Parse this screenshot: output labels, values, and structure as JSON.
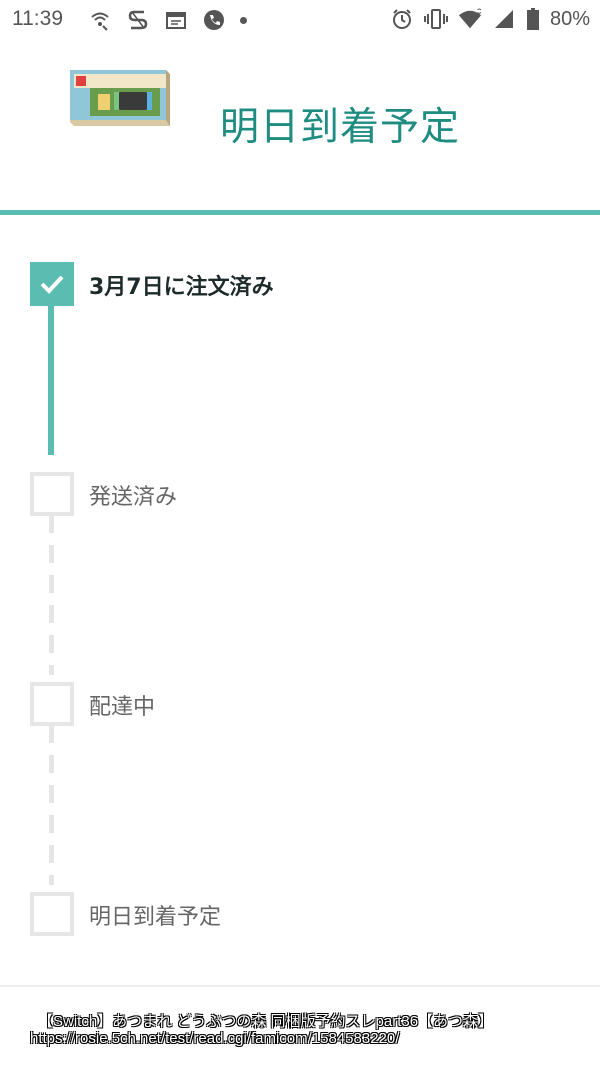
{
  "status_bar": {
    "time": "11:39",
    "battery": "80%",
    "left_icons": [
      "wifi-call-icon",
      "s-app-icon",
      "calendar-icon",
      "phone-icon",
      "notification-dot"
    ],
    "right_icons": [
      "alarm-icon",
      "vibrate-icon",
      "wifi-icon",
      "signal-icon",
      "battery-icon"
    ]
  },
  "header": {
    "title": "明日到着予定",
    "image": "product-box-image"
  },
  "timeline": {
    "steps": [
      {
        "label": "3月7日に注文済み",
        "completed": true
      },
      {
        "label": "発送済み",
        "completed": false
      },
      {
        "label": "配達中",
        "completed": false
      },
      {
        "label": "明日到着予定",
        "completed": false
      }
    ]
  },
  "caption": {
    "line1": "【Switch】あつまれ どうぶつの森 同梱版予約スレpart36【あつ森】",
    "line2": "https://rosie.5ch.net/test/read.cgi/famicom/1584583220/"
  },
  "colors": {
    "accent": "#5bbcb2",
    "title": "#1f8c81",
    "inactive": "#e6e6e6"
  }
}
